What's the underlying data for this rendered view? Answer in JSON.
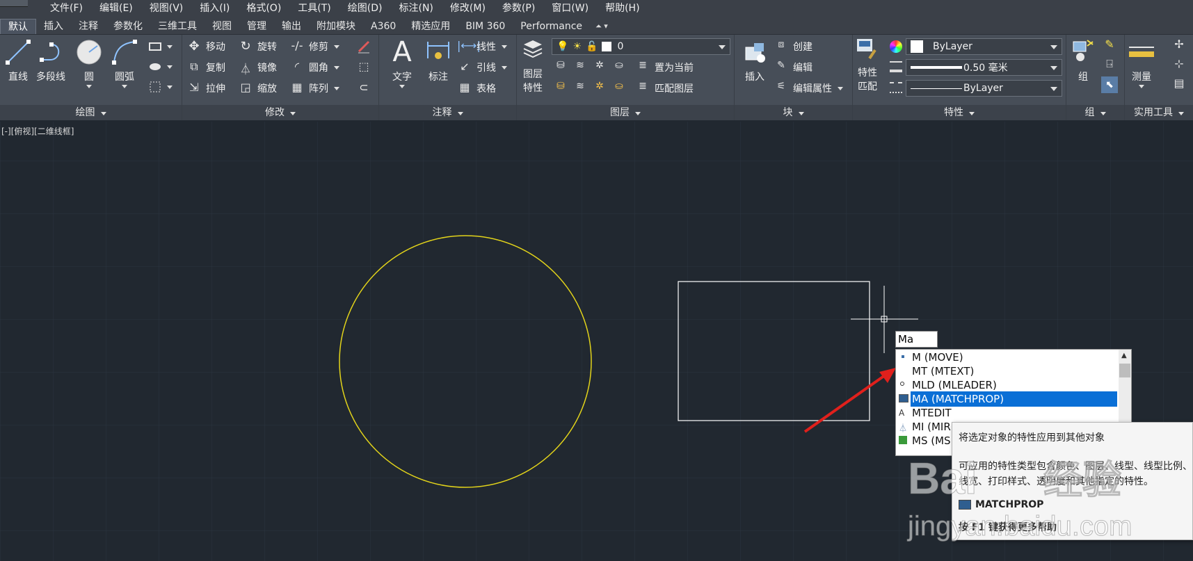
{
  "menubar": {
    "items": [
      "文件(F)",
      "编辑(E)",
      "视图(V)",
      "插入(I)",
      "格式(O)",
      "工具(T)",
      "绘图(D)",
      "标注(N)",
      "修改(M)",
      "参数(P)",
      "窗口(W)",
      "帮助(H)"
    ]
  },
  "tabs": {
    "items": [
      "默认",
      "插入",
      "注释",
      "参数化",
      "三维工具",
      "视图",
      "管理",
      "输出",
      "附加模块",
      "A360",
      "精选应用",
      "BIM 360",
      "Performance"
    ],
    "active": "默认"
  },
  "ribbon": {
    "draw": {
      "title": "绘图",
      "line": "直线",
      "polyline": "多段线",
      "circle": "圆",
      "arc": "圆弧"
    },
    "modify": {
      "title": "修改",
      "move": "移动",
      "rotate": "旋转",
      "trim": "修剪",
      "copy": "复制",
      "mirror": "镜像",
      "fillet": "圆角",
      "stretch": "拉伸",
      "scale": "缩放",
      "array": "阵列"
    },
    "annotation": {
      "title": "注释",
      "text": "文字",
      "dimension": "标注",
      "linear": "线性",
      "leader": "引线",
      "table": "表格"
    },
    "layers": {
      "title": "图层",
      "layer_properties_line1": "图层",
      "layer_properties_line2": "特性",
      "current_layer": "0",
      "make_current": "置为当前",
      "match_layer": "匹配图层"
    },
    "block": {
      "title": "块",
      "insert": "插入",
      "create": "创建",
      "edit": "编辑",
      "edit_attributes": "编辑属性"
    },
    "properties": {
      "title": "特性",
      "match_line1": "特性",
      "match_line2": "匹配",
      "color": "ByLayer",
      "lineweight": "0.50 毫米",
      "linetype": "ByLayer"
    },
    "groups": {
      "title": "组",
      "group": "组"
    },
    "utilities": {
      "title": "实用工具",
      "measure": "测量"
    }
  },
  "viewport": {
    "label": "[-][俯视][二维线框]",
    "circle_color": "#e3d41a",
    "rect_color": "#ffffff"
  },
  "command": {
    "input": "Ma"
  },
  "autocomplete": {
    "items": [
      {
        "label": "M (MOVE)",
        "icon": "move-icon"
      },
      {
        "label": "MT (MTEXT)",
        "icon": "none"
      },
      {
        "label": "MLD (MLEADER)",
        "icon": "leader-icon"
      },
      {
        "label": "MA (MATCHPROP)",
        "icon": "matchprop-icon",
        "selected": true
      },
      {
        "label": "MTEDIT",
        "icon": "mtedit-icon"
      },
      {
        "label": "MI (MIR",
        "icon": "mirror-icon"
      },
      {
        "label": "MS (MS",
        "icon": "mspace-icon"
      }
    ],
    "selected_color": "#0a6fd6"
  },
  "tooltip": {
    "title": "将选定对象的特性应用到其他对象",
    "description": "可应用的特性类型包含颜色、图层、线型、线型比例、线宽、打印样式、透明度和其他指定的特性。",
    "command": "MATCHPROP",
    "help": "按 F1 键获得更多帮助"
  },
  "watermark": {
    "text": "Bai 经验",
    "url": "jingyan.baidu.com"
  },
  "annotation_arrow_color": "#e0201c"
}
